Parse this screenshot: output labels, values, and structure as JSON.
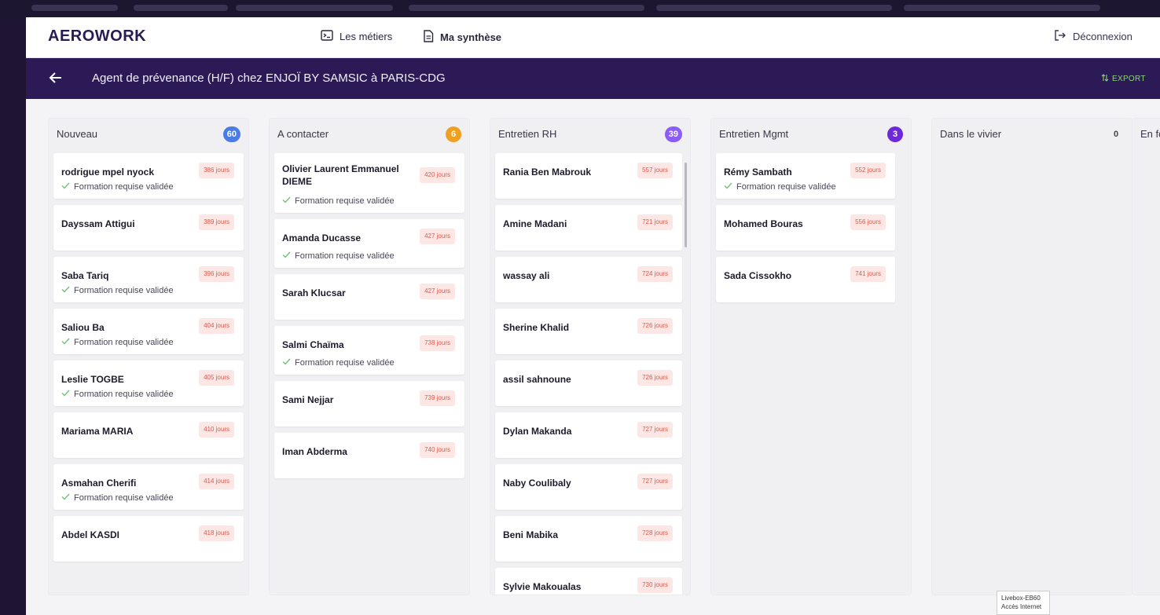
{
  "app": {
    "logo": "AEROWORK",
    "nav": [
      {
        "label": "Les métiers",
        "icon": "terminal-icon"
      },
      {
        "label": "Ma synthèse",
        "icon": "document-icon"
      }
    ],
    "logout_label": "Déconnexion"
  },
  "header": {
    "title": "Agent de prévenance (H/F) chez ENJOÏ BY SAMSIC à PARIS-CDG",
    "export_label": "EXPORT"
  },
  "colors": {
    "brand": "#2c1a57",
    "badge_blue": "#4b7be5",
    "badge_orange": "#f0a020",
    "badge_purple": "#8b5cf6",
    "badge_violet": "#6d28d9",
    "days_text": "#e0584a",
    "check": "#6fbf73"
  },
  "columns": [
    {
      "title": "Nouveau",
      "count": "60",
      "badge_color": "#4b7be5",
      "cards": [
        {
          "name": "rodrigue mpel nyock",
          "days": "386 jours",
          "formation": "Formation requise validée"
        },
        {
          "name": "Dayssam Attigui",
          "days": "389 jours",
          "formation": ""
        },
        {
          "name": "Saba Tariq",
          "days": "396 jours",
          "formation": "Formation requise validée"
        },
        {
          "name": "Saliou Ba",
          "days": "404 jours",
          "formation": "Formation requise validée"
        },
        {
          "name": "Leslie TOGBE",
          "days": "405 jours",
          "formation": "Formation requise validée"
        },
        {
          "name": "Mariama MARIA",
          "days": "410 jours",
          "formation": ""
        },
        {
          "name": "Asmahan Cherifi",
          "days": "414 jours",
          "formation": "Formation requise validée"
        },
        {
          "name": "Abdel KASDI",
          "days": "418 jours",
          "formation": ""
        }
      ]
    },
    {
      "title": "A contacter",
      "count": "6",
      "badge_color": "#f0a020",
      "cards": [
        {
          "name": "Olivier Laurent Emmanuel DIEME",
          "days": "420 jours",
          "formation": "Formation requise validée"
        },
        {
          "name": "Amanda Ducasse",
          "days": "427 jours",
          "formation": "Formation requise validée"
        },
        {
          "name": "Sarah Klucsar",
          "days": "427 jours",
          "formation": ""
        },
        {
          "name": "Salmi Chaïma",
          "days": "738 jours",
          "formation": "Formation requise validée"
        },
        {
          "name": "Sami Nejjar",
          "days": "739 jours",
          "formation": ""
        },
        {
          "name": "Iman Abderma",
          "days": "740 jours",
          "formation": ""
        }
      ]
    },
    {
      "title": "Entretien RH",
      "count": "39",
      "badge_color": "#8b5cf6",
      "cards": [
        {
          "name": "Rania Ben Mabrouk",
          "days": "557 jours",
          "formation": ""
        },
        {
          "name": "Amine Madani",
          "days": "721 jours",
          "formation": ""
        },
        {
          "name": "wassay ali",
          "days": "724 jours",
          "formation": ""
        },
        {
          "name": "Sherine Khalid",
          "days": "726 jours",
          "formation": ""
        },
        {
          "name": "assil sahnoune",
          "days": "726 jours",
          "formation": ""
        },
        {
          "name": "Dylan Makanda",
          "days": "727 jours",
          "formation": ""
        },
        {
          "name": "Naby Coulibaly",
          "days": "727 jours",
          "formation": ""
        },
        {
          "name": "Beni Mabika",
          "days": "728 jours",
          "formation": ""
        },
        {
          "name": "Sylvie Makoualas",
          "days": "730 jours",
          "formation": ""
        }
      ]
    },
    {
      "title": "Entretien Mgmt",
      "count": "3",
      "badge_color": "#6d28d9",
      "cards": [
        {
          "name": "Rémy Sambath",
          "days": "552 jours",
          "formation": "Formation requise validée"
        },
        {
          "name": "Mohamed Bouras",
          "days": "556 jours",
          "formation": ""
        },
        {
          "name": "Sada Cissokho",
          "days": "741 jours",
          "formation": ""
        }
      ]
    },
    {
      "title": "Dans le vivier",
      "count": "0",
      "badge_color": "",
      "cards": []
    },
    {
      "title": "En fo",
      "count": "",
      "badge_color": "",
      "cards": []
    }
  ],
  "system": {
    "livebox_line1": "Livebox-EB60",
    "livebox_line2": "Accès Internet"
  }
}
